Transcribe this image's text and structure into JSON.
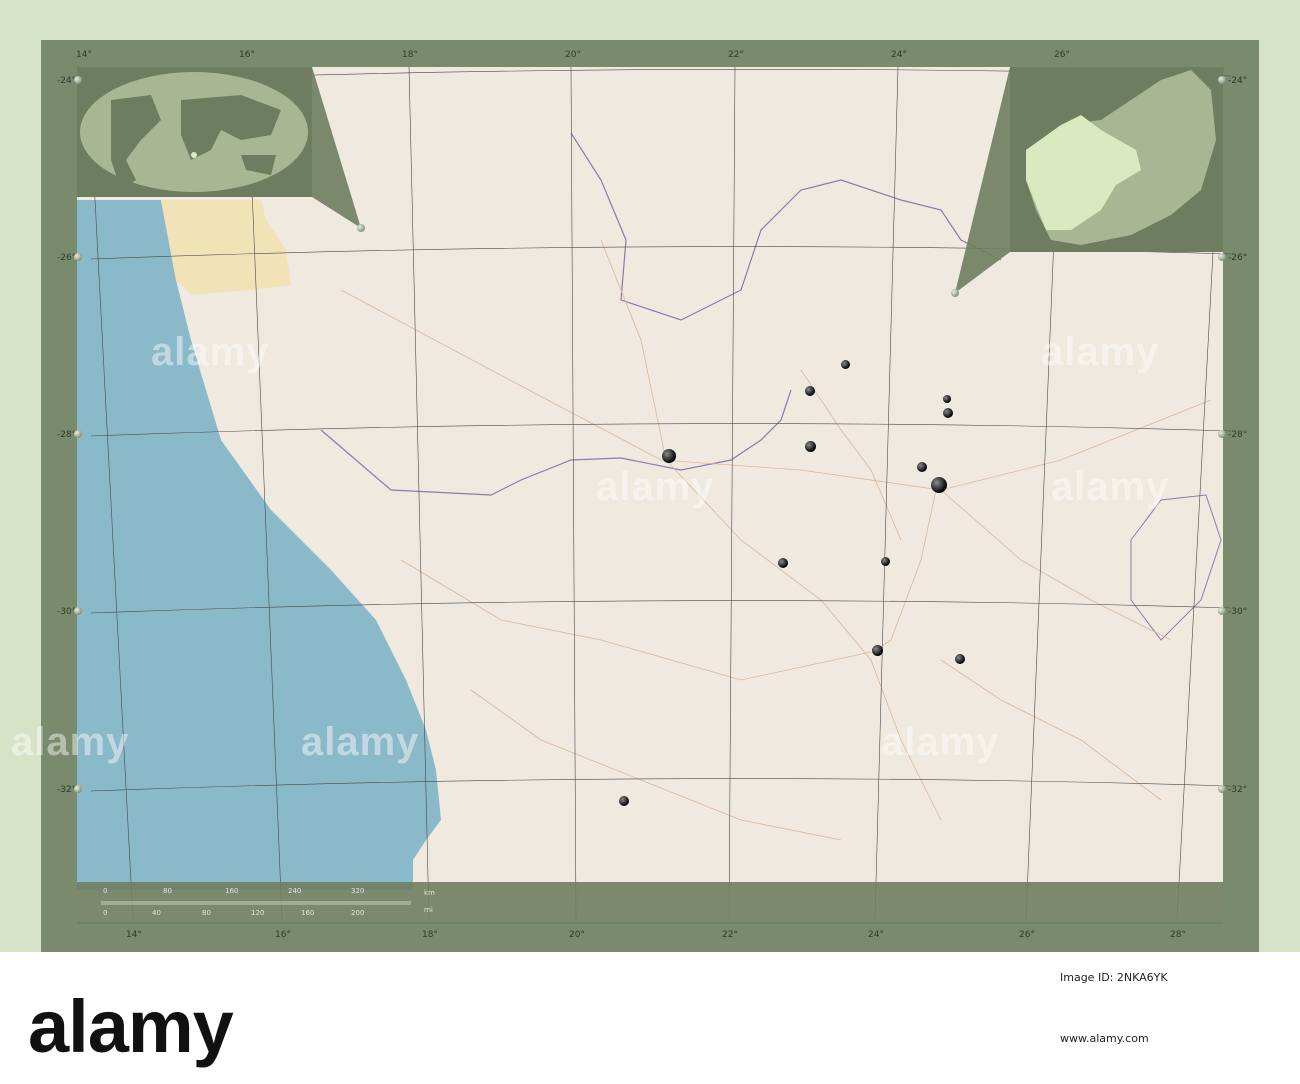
{
  "map": {
    "lon_labels_top": [
      "14°",
      "16°",
      "18°",
      "20°",
      "22°",
      "24°",
      "26°"
    ],
    "lon_labels_bottom": [
      "14°",
      "16°",
      "18°",
      "20°",
      "22°",
      "24°",
      "26°",
      "28°"
    ],
    "lat_labels_left": [
      "-24°",
      "-26°",
      "-28°",
      "-30°",
      "-32°"
    ],
    "lat_labels_right": [
      "-24°",
      "-26°",
      "-28°",
      "-30°",
      "-32°"
    ],
    "scale_km_label": "km",
    "scale_mi_label": "mi",
    "scale_km_ticks": [
      "0",
      "80",
      "160",
      "240",
      "320"
    ],
    "scale_mi_ticks": [
      "0",
      "40",
      "80",
      "120",
      "160",
      "200"
    ],
    "watermark": "alamy",
    "colors": {
      "ocean": "#8ab9c9",
      "land": "#efe9e0",
      "frame": "#7a8a6c",
      "inset": "#6e7d5f",
      "highlight": "#dbe9c0"
    }
  },
  "footer": {
    "brand": "alamy",
    "image_id_label": "Image ID: 2NKA6YK",
    "url": "www.alamy.com"
  }
}
